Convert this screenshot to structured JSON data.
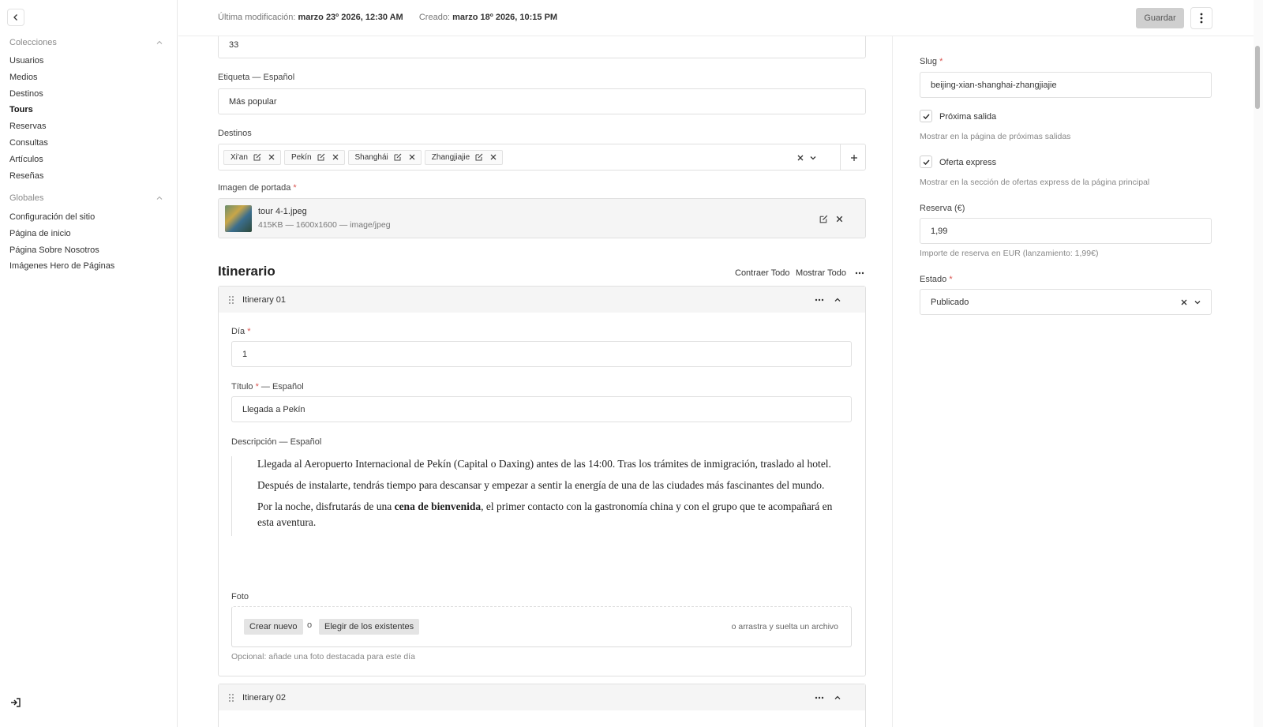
{
  "sidebar": {
    "collections_title": "Colecciones",
    "collections": [
      "Usuarios",
      "Medios",
      "Destinos",
      "Tours",
      "Reservas",
      "Consultas",
      "Artículos",
      "Reseñas"
    ],
    "active_collection": "Tours",
    "globals_title": "Globales",
    "globals": [
      "Configuración del sitio",
      "Página de inicio",
      "Página Sobre Nosotros",
      "Imágenes Hero de Páginas"
    ]
  },
  "header": {
    "last_modified_label": "Última modificación:",
    "last_modified_value": "marzo 23º 2026, 12:30 AM",
    "created_label": "Creado:",
    "created_value": "marzo 18º 2026, 10:15 PM",
    "save_label": "Guardar"
  },
  "main": {
    "number_value": "33",
    "etiqueta_label": "Etiqueta — Español",
    "etiqueta_value": "Más popular",
    "destinos_label": "Destinos",
    "destinos": [
      "Xi'an",
      "Pekín",
      "Shanghái",
      "Zhangjiajie"
    ],
    "cover_label": "Imagen de portada",
    "cover_file": "tour 4-1.jpeg",
    "cover_meta": "415KB — 1600x1600 — image/jpeg",
    "itinerary_title": "Itinerario",
    "collapse_all": "Contraer Todo",
    "show_all": "Mostrar Todo",
    "row1": {
      "title": "Itinerary 01",
      "day_label": "Día",
      "day_value": "1",
      "title_label": "Título",
      "title_suffix": " — Español",
      "title_value": "Llegada a Pekín",
      "desc_label": "Descripción — Español",
      "p1": "Llegada al Aeropuerto Internacional de Pekín (Capital o Daxing) antes de las 14:00. Tras los trámites de inmigración, traslado al hotel.",
      "p2": "Después de instalarte, tendrás tiempo para descansar y empezar a sentir la energía de una de las ciudades más fascinantes del mundo.",
      "p3_before": "Por la noche, disfrutarás de una ",
      "p3_bold": "cena de bienvenida",
      "p3_after": ", el primer contacto con la gastronomía china y con el grupo que te acompañará en esta aventura.",
      "photo_label": "Foto",
      "create_new": "Crear nuevo",
      "or": "o",
      "choose_existing": "Elegir de los existentes",
      "drag_drop": "o arrastra y suelta un archivo",
      "photo_hint": "Opcional: añade una foto destacada para este día"
    },
    "row2": {
      "title": "Itinerary 02"
    }
  },
  "right": {
    "slug_label": "Slug",
    "slug_value": "beijing-xian-shanghai-zhangjiajie",
    "next_departure_label": "Próxima salida",
    "next_departure_hint": "Mostrar en la página de próximas salidas",
    "next_departure_checked": true,
    "express_label": "Oferta express",
    "express_hint": "Mostrar en la sección de ofertas express de la página principal",
    "express_checked": true,
    "reserva_label": "Reserva (€)",
    "reserva_value": "1,99",
    "reserva_hint": "Importe de reserva en EUR (lanzamiento: 1,99€)",
    "estado_label": "Estado",
    "estado_value": "Publicado"
  },
  "colors": {
    "accent_required": "#d9534f",
    "save_bg": "#cfcfcf",
    "panel_bg": "#f5f5f5"
  }
}
